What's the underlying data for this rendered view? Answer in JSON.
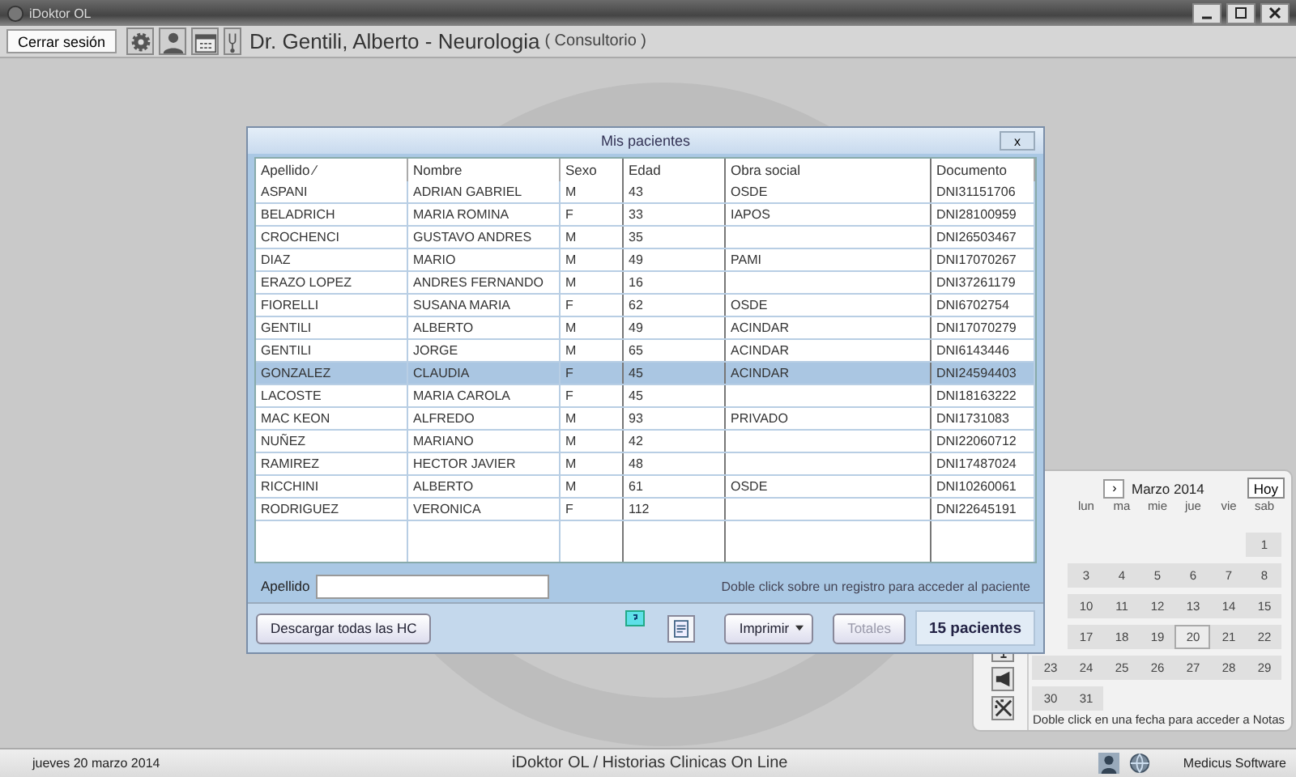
{
  "window": {
    "title": "iDoktor OL"
  },
  "toolbar": {
    "logout": "Cerrar sesión",
    "doctor": "Dr. Gentili, Alberto - Neurologia",
    "place": "( Consultorio )"
  },
  "dialog": {
    "title": "Mis pacientes",
    "close": "x",
    "columns": [
      "Apellido ⁄",
      "Nombre",
      "Sexo",
      "Edad",
      "Obra social",
      "Documento"
    ],
    "rows": [
      {
        "apellido": "ASPANI",
        "nombre": "ADRIAN GABRIEL",
        "sexo": "M",
        "edad": "43",
        "obra_social": "OSDE",
        "documento": "DNI31151706",
        "selected": false
      },
      {
        "apellido": "BELADRICH",
        "nombre": "MARIA ROMINA",
        "sexo": "F",
        "edad": "33",
        "obra_social": "IAPOS",
        "documento": "DNI28100959",
        "selected": false
      },
      {
        "apellido": "CROCHENCI",
        "nombre": "GUSTAVO ANDRES",
        "sexo": "M",
        "edad": "35",
        "documento": "DNI26503467",
        "selected": false
      },
      {
        "apellido": "DIAZ",
        "nombre": "MARIO",
        "sexo": "M",
        "edad": "49",
        "obra_social": "PAMI",
        "documento": "DNI17070267",
        "selected": false
      },
      {
        "apellido": "ERAZO LOPEZ",
        "nombre": "ANDRES FERNANDO",
        "sexo": "M",
        "edad": "16",
        "documento": "DNI37261179",
        "selected": false
      },
      {
        "apellido": "FIORELLI",
        "nombre": "SUSANA MARIA",
        "sexo": "F",
        "edad": "62",
        "obra_social": "OSDE",
        "documento": "DNI6702754",
        "selected": false
      },
      {
        "apellido": "GENTILI",
        "nombre": "ALBERTO",
        "sexo": "M",
        "edad": "49",
        "obra_social": "ACINDAR",
        "documento": "DNI17070279",
        "selected": false
      },
      {
        "apellido": "GENTILI",
        "nombre": "JORGE",
        "sexo": "M",
        "edad": "65",
        "obra_social": "ACINDAR",
        "documento": "DNI6143446",
        "selected": false
      },
      {
        "apellido": "GONZALEZ",
        "nombre": "CLAUDIA",
        "sexo": "F",
        "edad": "45",
        "obra_social": "ACINDAR",
        "documento": "DNI24594403",
        "selected": true
      },
      {
        "apellido": "LACOSTE",
        "nombre": "MARIA CAROLA",
        "sexo": "F",
        "edad": "45",
        "documento": "DNI18163222",
        "selected": false
      },
      {
        "apellido": "MAC KEON",
        "nombre": "ALFREDO",
        "sexo": "M",
        "edad": "93",
        "obra_social": "PRIVADO",
        "documento": "DNI1731083",
        "selected": false
      },
      {
        "apellido": "NUÑEZ",
        "nombre": "MARIANO",
        "sexo": "M",
        "edad": "42",
        "documento": "DNI22060712",
        "selected": false
      },
      {
        "apellido": "RAMIREZ",
        "nombre": "HECTOR JAVIER",
        "sexo": "M",
        "edad": "48",
        "documento": "DNI17487024",
        "selected": false
      },
      {
        "apellido": "RICCHINI",
        "nombre": "ALBERTO",
        "sexo": "M",
        "edad": "61",
        "obra_social": "OSDE",
        "documento": "DNI10260061",
        "selected": false
      },
      {
        "apellido": "RODRIGUEZ",
        "nombre": "VERONICA",
        "sexo": "F",
        "edad": "112",
        "documento": "DNI22645191",
        "selected": false
      }
    ],
    "filter_label": "Apellido",
    "hint": "Doble click sobre un registro para acceder al paciente",
    "download": "Descargar todas las HC",
    "print": "Imprimir",
    "totals": "Totales",
    "totals_disabled": true,
    "count": "15 pacientes"
  },
  "calendar": {
    "next": "›",
    "month": "Marzo 2014",
    "today": "Hoy",
    "weekdays": [
      "lun",
      "ma",
      "mie",
      "jue",
      "vie",
      "sab"
    ],
    "weeks": [
      [
        {
          "day": "1",
          "selected": false
        }
      ],
      [
        {
          "day": "3",
          "selected": false
        },
        {
          "day": "4",
          "selected": false
        },
        {
          "day": "5",
          "selected": false
        },
        {
          "day": "6",
          "selected": false
        },
        {
          "day": "7",
          "selected": false
        },
        {
          "day": "8",
          "selected": false
        }
      ],
      [
        {
          "day": "10",
          "selected": false
        },
        {
          "day": "11",
          "selected": false
        },
        {
          "day": "12",
          "selected": false
        },
        {
          "day": "13",
          "selected": false
        },
        {
          "day": "14",
          "selected": false
        },
        {
          "day": "15",
          "selected": false
        }
      ],
      [
        {
          "day": "17",
          "selected": false
        },
        {
          "day": "18",
          "selected": false
        },
        {
          "day": "19",
          "selected": false
        },
        {
          "day": "20",
          "selected": true
        },
        {
          "day": "21",
          "selected": false
        },
        {
          "day": "22",
          "selected": false
        }
      ],
      [
        {
          "day": "23",
          "selected": false
        },
        {
          "day": "24",
          "selected": false
        },
        {
          "day": "25",
          "selected": false
        },
        {
          "day": "26",
          "selected": false
        },
        {
          "day": "27",
          "selected": false
        },
        {
          "day": "28",
          "selected": false
        },
        {
          "day": "29",
          "selected": false
        }
      ],
      [
        {
          "day": "30",
          "selected": false
        },
        {
          "day": "31",
          "selected": false
        }
      ]
    ],
    "footer": "Doble click en una fecha para acceder a Notas"
  },
  "status_bar": {
    "date": "jueves 20 marzo 2014",
    "app": "iDoktor OL  /  Historias Clinicas On Line",
    "vendor": "Medicus Software"
  }
}
